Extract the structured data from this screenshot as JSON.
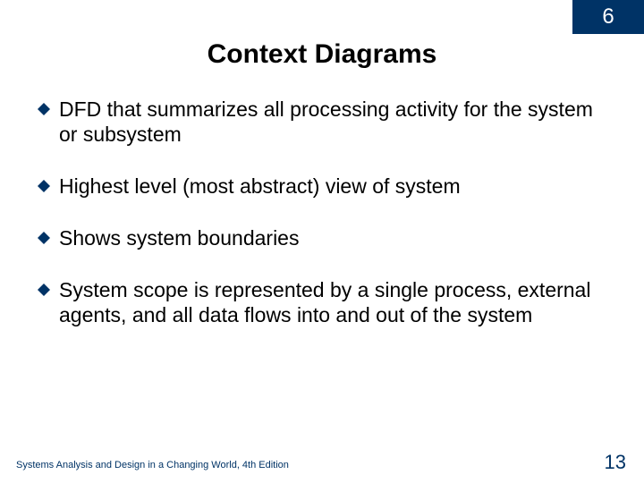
{
  "chapter_number": "6",
  "title": "Context Diagrams",
  "bullets": [
    "DFD that summarizes all processing activity for the system or subsystem",
    "Highest level (most abstract) view of system",
    "Shows system boundaries",
    "System scope is represented by a single process, external agents, and all data flows into and out of the system"
  ],
  "footer": {
    "left": "Systems Analysis and Design in a Changing World, 4th Edition",
    "page": "13"
  },
  "colors": {
    "brand": "#003366"
  }
}
